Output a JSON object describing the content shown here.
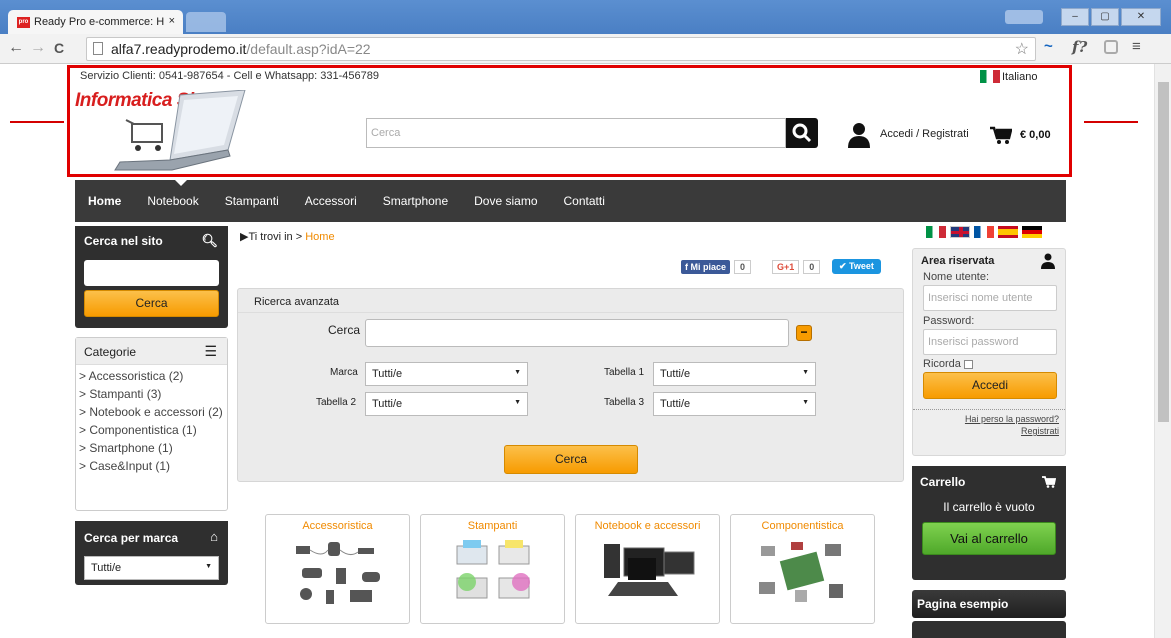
{
  "browser": {
    "tab_title": "Ready Pro e-commerce: H",
    "tab_close": "×",
    "favicon_text": "pro",
    "url_domain": "alfa7.readyprodemo.it",
    "url_path": "/default.asp?idA=22",
    "nav_back": "←",
    "nav_forward": "→",
    "reload": "C",
    "star": "☆",
    "ext1": "~",
    "ext2": "f?",
    "menu": "≡",
    "win_min": "–",
    "win_max": "▢",
    "win_close": "✕"
  },
  "header": {
    "service": "Servizio Clienti: 0541-987654 - Cell e Whatsapp: 331-456789",
    "language": "Italiano",
    "logo": "Informatica Shop",
    "logo_mark": "®",
    "search_placeholder": "Cerca",
    "login": "Accedi / Registrati",
    "cart_total": "€ 0,00"
  },
  "menu": [
    "Home",
    "Notebook",
    "Stampanti",
    "Accessori",
    "Smartphone",
    "Dove siamo",
    "Contatti"
  ],
  "left": {
    "search_title": "Cerca nel sito",
    "search_button": "Cerca",
    "categories_title": "Categorie",
    "categories": [
      "> Accessoristica (2)",
      "> Stampanti (3)",
      "> Notebook e accessori (2)",
      "> Componentistica (1)",
      "> Smartphone (1)",
      "> Case&Input (1)"
    ],
    "brand_title": "Cerca per marca",
    "brand_value": "Tutti/e"
  },
  "main": {
    "breadcrumb_prefix": "Ti trovi in > ",
    "breadcrumb_current": "Home",
    "fb_label": "Mi piace",
    "fb_count": "0",
    "gplus_label": "G+1",
    "gplus_count": "0",
    "tweet_label": "Tweet",
    "advanced": {
      "title": "Ricerca avanzata",
      "search_label": "Cerca",
      "marca_label": "Marca",
      "marca_value": "Tutti/e",
      "tab1_label": "Tabella 1",
      "tab1_value": "Tutti/e",
      "tab2_label": "Tabella 2",
      "tab2_value": "Tutti/e",
      "tab3_label": "Tabella 3",
      "tab3_value": "Tutti/e",
      "button": "Cerca",
      "collapse": "−"
    },
    "products": [
      "Accessoristica",
      "Stampanti",
      "Notebook e accessori",
      "Componentistica"
    ]
  },
  "right": {
    "area_title": "Area riservata",
    "username_label": "Nome utente:",
    "username_placeholder": "Inserisci nome utente",
    "password_label": "Password:",
    "password_placeholder": "Inserisci password",
    "remember": "Ricorda",
    "login_button": "Accedi",
    "forgot": "Hai perso la password?",
    "register": "Registrati",
    "cart_title": "Carrello",
    "cart_empty": "Il carrello è vuoto",
    "cart_button": "Vai al carrello",
    "sample_page": "Pagina esempio"
  },
  "colors": {
    "accent_orange": "#f79b00",
    "highlight_red": "#e00000",
    "dark_bar": "#3a3a3a",
    "cart_green": "#5cb82c"
  }
}
